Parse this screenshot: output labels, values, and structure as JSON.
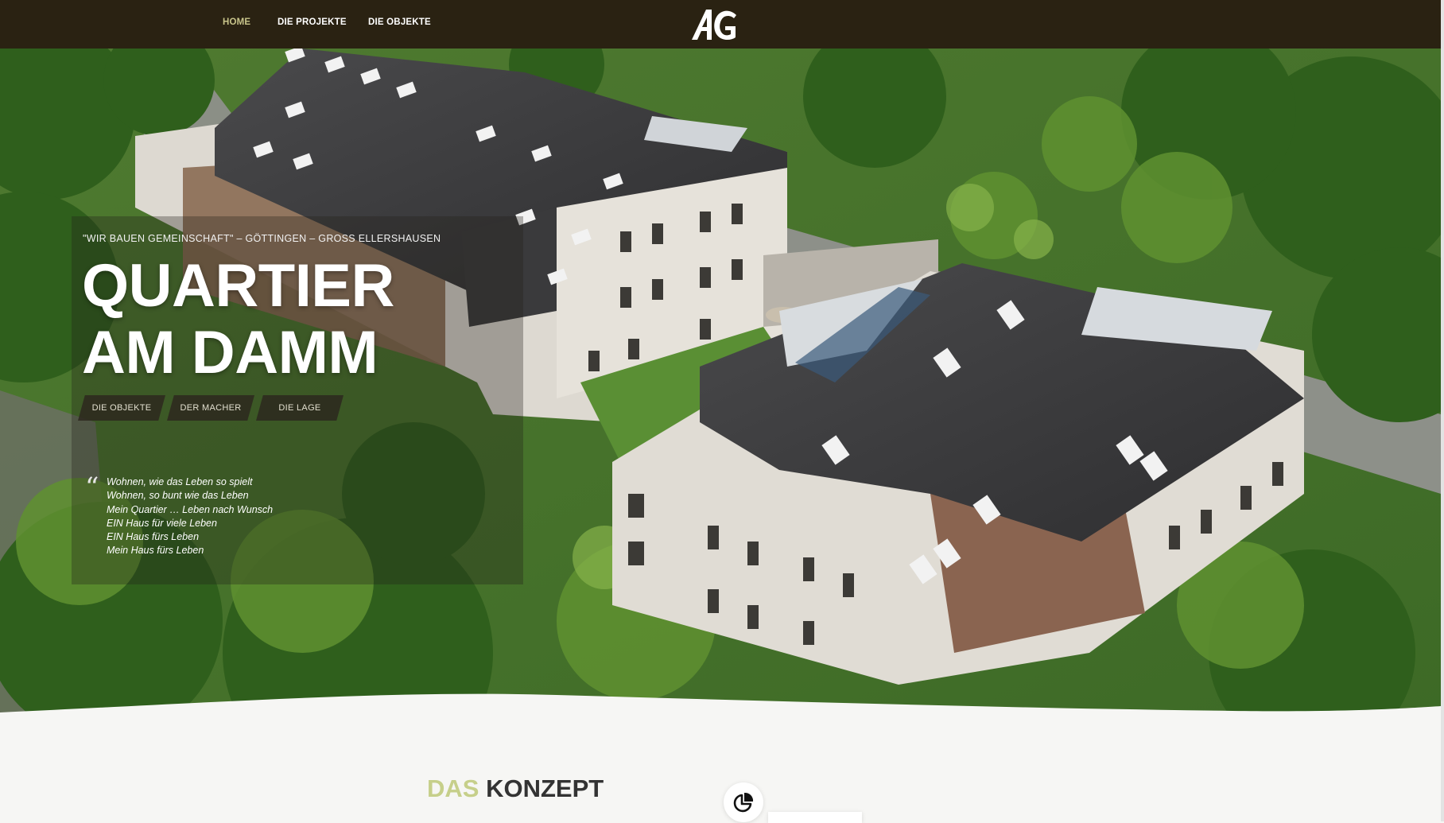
{
  "nav": {
    "items": [
      {
        "label": "HOME",
        "active": true
      },
      {
        "label": "DIE PROJEKTE",
        "active": false
      },
      {
        "label": "DIE OBJEKTE",
        "active": false
      }
    ],
    "logo_text": "AG"
  },
  "hero": {
    "eyebrow": "\"WIR BAUEN GEMEINSCHAFT\" – GÖTTINGEN – GROSS ELLERSHAUSEN",
    "title_line1": "QUARTIER",
    "title_line2": "AM DAMM",
    "buttons": [
      "DIE OBJEKTE",
      "DER MACHER",
      "DIE LAGE"
    ],
    "quote_mark": "“",
    "quote_lines": [
      "Wohnen, wie das Leben so spielt",
      "Wohnen, so bunt wie das Leben",
      "Mein Quartier … Leben nach Wunsch",
      "EIN Haus für viele Leben",
      "EIN Haus fürs Leben",
      "Mein Haus fürs Leben"
    ]
  },
  "section": {
    "heading_accent": "DAS",
    "heading_rest": "KONZEPT",
    "icon": "pie-chart-icon"
  },
  "colors": {
    "topbar": "#2a2212",
    "nav_active": "#c8c48a",
    "heading_accent": "#c6cf8a",
    "page_background": "#f6f6f4"
  }
}
